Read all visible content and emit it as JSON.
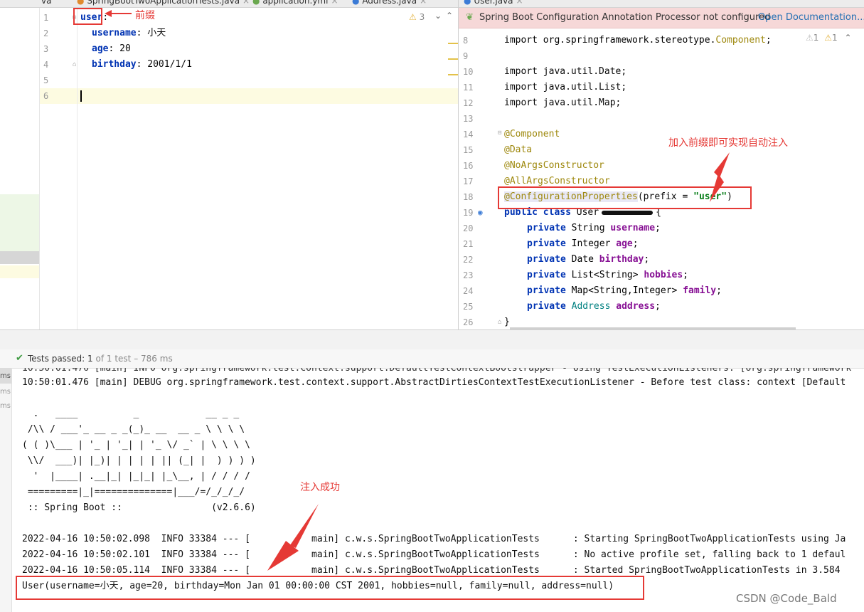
{
  "tabs": [
    {
      "label": "va"
    },
    {
      "label": "SpringBootTwoApplicationTests.java"
    },
    {
      "label": "application.yml"
    },
    {
      "label": "Address.java"
    },
    {
      "label": "User.java"
    }
  ],
  "yml_editor": {
    "line_numbers": [
      "1",
      "2",
      "3",
      "4",
      "5",
      "6"
    ],
    "lines": [
      {
        "key": "user",
        "sep": ":",
        "value": ""
      },
      {
        "key": "username",
        "sep": ": ",
        "value": "小天"
      },
      {
        "key": "age",
        "sep": ": ",
        "value": "20"
      },
      {
        "key": "birthday",
        "sep": ": ",
        "value": "2001/1/1"
      }
    ],
    "warning_count": "3",
    "annotation_prefix": "前缀"
  },
  "java_editor": {
    "notification": {
      "message": "Spring Boot Configuration Annotation Processor not configured",
      "link": "Open Documentation..."
    },
    "inspection": {
      "warn": "1",
      "weak": "1"
    },
    "line_numbers": [
      "8",
      "9",
      "10",
      "11",
      "12",
      "13",
      "14",
      "15",
      "16",
      "17",
      "18",
      "19",
      "20",
      "21",
      "22",
      "23",
      "24",
      "25",
      "26"
    ],
    "imports": {
      "l8": "import org.springframework.stereotype.",
      "l8_cls": "Component",
      "l10": "import java.util.Date;",
      "l11": "import java.util.List;",
      "l12": "import java.util.Map;"
    },
    "annotations": {
      "component": "@Component",
      "data": "@Data",
      "noargs": "@NoArgsConstructor",
      "allargs": "@AllArgsConstructor",
      "config": "@ConfigurationProperties",
      "config_arg_open": "(prefix = ",
      "config_arg_value": "\"user\"",
      "config_arg_close": ")"
    },
    "class_decl": {
      "public": "public",
      "class": "class",
      "name": "User",
      "brace": "{"
    },
    "fields": [
      {
        "mod": "private",
        "type": "String",
        "name": "username"
      },
      {
        "mod": "private",
        "type": "Integer",
        "name": "age"
      },
      {
        "mod": "private",
        "type": "Date",
        "name": "birthday"
      },
      {
        "mod": "private",
        "type": "List<String>",
        "name": "hobbies"
      },
      {
        "mod": "private",
        "type": "Map<String,Integer>",
        "name": "family"
      },
      {
        "mod": "private",
        "type": "Address",
        "name": "address"
      }
    ],
    "closing_brace": "}",
    "annotation_prefix_note": "加入前缀即可实现自动注入"
  },
  "run_panel": {
    "status_prefix": "Tests passed:",
    "passed": "1",
    "total_text": "of 1 test",
    "duration": "– 786 ms",
    "left_times": [
      "ms",
      "ms",
      "ms"
    ]
  },
  "console": {
    "line_top_partial": "10:50:01.476 [main] INFO org.springframework.test.context.support.DefaultTestContextBootstrapper - Using TestExecutionListeners: [org.springframework",
    "line_debug": "10:50:01.476 [main] DEBUG org.springframework.test.context.support.AbstractDirtiesContextTestExecutionListener - Before test class: context [Default",
    "banner": [
      "  .   ____          _            __ _ _",
      " /\\\\ / ___'_ __ _ _(_)_ __  __ _ \\ \\ \\ \\",
      "( ( )\\___ | '_ | '_| | '_ \\/ _` | \\ \\ \\ \\",
      " \\\\/  ___)| |_)| | | | | || (_| |  ) ) ) )",
      "  '  |____| .__|_| |_|_| |_\\__, | / / / /",
      " =========|_|==============|___/=/_/_/_/",
      " :: Spring Boot ::                (v2.6.6)"
    ],
    "log_lines": [
      "2022-04-16 10:50:02.098  INFO 33384 --- [           main] c.w.s.SpringBootTwoApplicationTests      : Starting SpringBootTwoApplicationTests using Ja",
      "2022-04-16 10:50:02.101  INFO 33384 --- [           main] c.w.s.SpringBootTwoApplicationTests      : No active profile set, falling back to 1 defaul",
      "2022-04-16 10:50:05.114  INFO 33384 --- [           main] c.w.s.SpringBootTwoApplicationTests      : Started SpringBootTwoApplicationTests in 3.584"
    ],
    "result": "User(username=小天, age=20, birthday=Mon Jan 01 00:00:00 CST 2001, hobbies=null, family=null, address=null)",
    "annotation_success": "注入成功"
  },
  "watermark": "CSDN @Code_Bald"
}
